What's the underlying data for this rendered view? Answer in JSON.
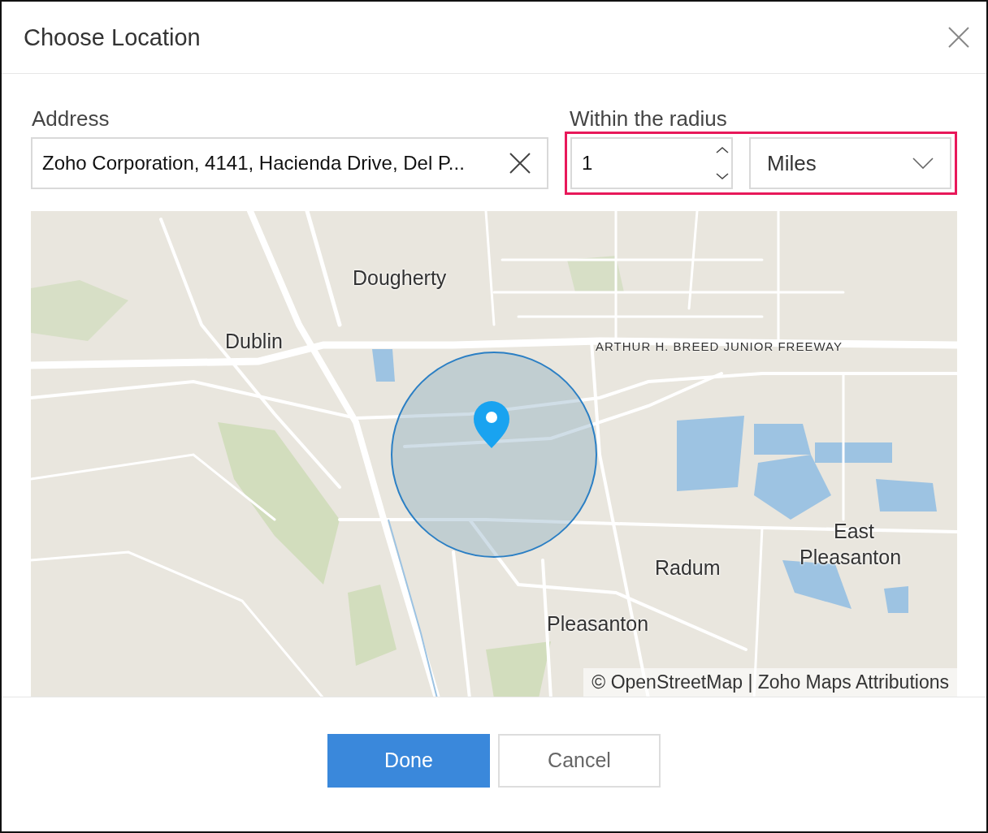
{
  "dialog": {
    "title": "Choose Location"
  },
  "address": {
    "label": "Address",
    "value": "Zoho Corporation, 4141, Hacienda Drive, Del P..."
  },
  "radius": {
    "label": "Within the radius",
    "value": "1",
    "unit": "Miles",
    "highlighted": true
  },
  "map": {
    "labels": [
      {
        "text": "Dougherty",
        "kind": "place"
      },
      {
        "text": "Dublin",
        "kind": "place"
      },
      {
        "text": "ARTHUR H. BREED JUNIOR FREEWAY",
        "kind": "road"
      },
      {
        "text": "East",
        "kind": "place"
      },
      {
        "text": "Pleasanton",
        "kind": "place"
      },
      {
        "text": "Radum",
        "kind": "place"
      },
      {
        "text": "Pleasanton",
        "kind": "place"
      }
    ],
    "attribution": "© OpenStreetMap | Zoho Maps Attributions"
  },
  "buttons": [
    {
      "label": "Done",
      "kind": "primary"
    },
    {
      "label": "Cancel",
      "kind": "secondary"
    }
  ]
}
